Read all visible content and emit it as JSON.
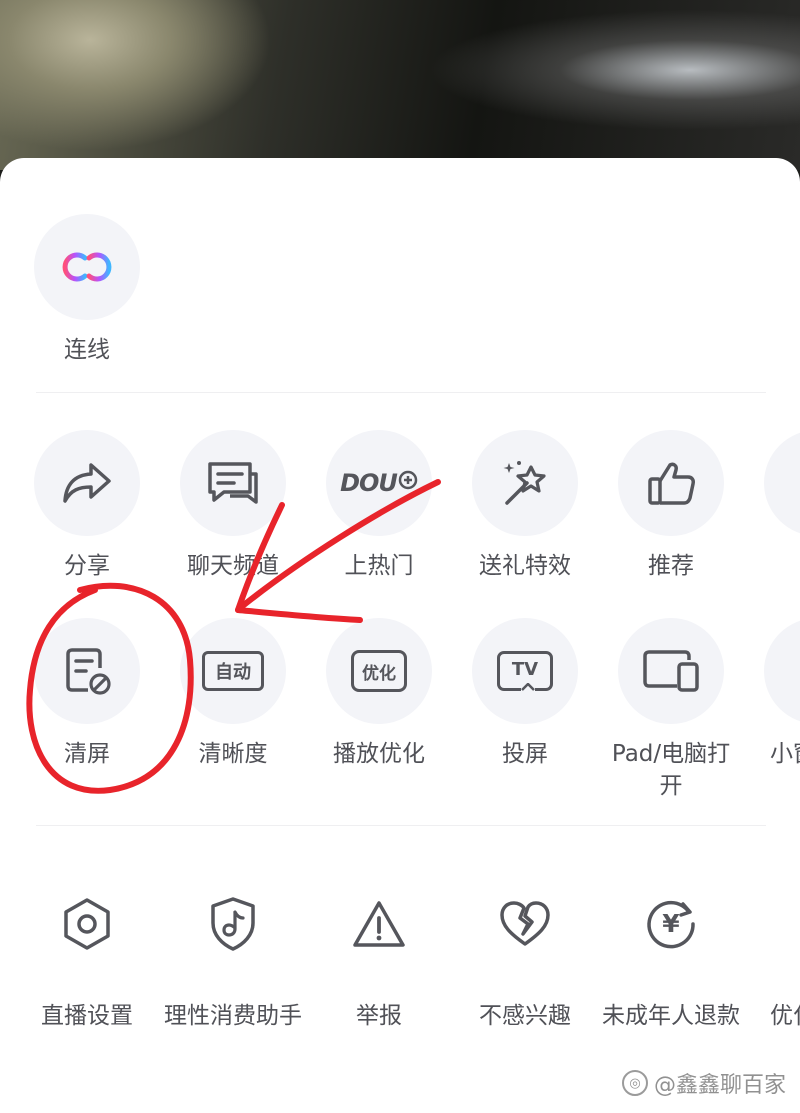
{
  "featured": {
    "label": "连线"
  },
  "row1": [
    {
      "label": "分享",
      "icon": "share-icon"
    },
    {
      "label": "聊天频道",
      "icon": "chat-icon"
    },
    {
      "label": "上热门",
      "icon": "dou-plus-icon",
      "icon_text": "DOU"
    },
    {
      "label": "送礼特效",
      "icon": "gift-effects-icon"
    },
    {
      "label": "推荐",
      "icon": "thumbs-up-icon"
    }
  ],
  "row2": [
    {
      "label": "清屏",
      "icon": "clear-screen-icon"
    },
    {
      "label": "清晰度",
      "icon": "resolution-icon",
      "icon_text": "自动"
    },
    {
      "label": "播放优化",
      "icon": "playback-optimize-icon",
      "icon_text": "优化"
    },
    {
      "label": "投屏",
      "icon": "tv-cast-icon",
      "icon_text": "TV"
    },
    {
      "label": "Pad/电脑打开",
      "icon": "pad-computer-icon"
    }
  ],
  "row2_partial_label": "小窗",
  "row3": [
    {
      "label": "直播设置",
      "icon": "settings-hex-icon"
    },
    {
      "label": "理性消费助手",
      "icon": "shield-music-icon"
    },
    {
      "label": "举报",
      "icon": "warning-icon"
    },
    {
      "label": "不感兴趣",
      "icon": "broken-heart-icon"
    },
    {
      "label": "未成年人退款",
      "icon": "yen-refund-icon",
      "icon_text": "¥"
    }
  ],
  "row3_partial_label": "优化",
  "watermark": {
    "text": "@鑫鑫聊百家"
  },
  "colors": {
    "annotation": "#e8242b",
    "icon": "#55565c",
    "circle": "#f3f4f8"
  }
}
